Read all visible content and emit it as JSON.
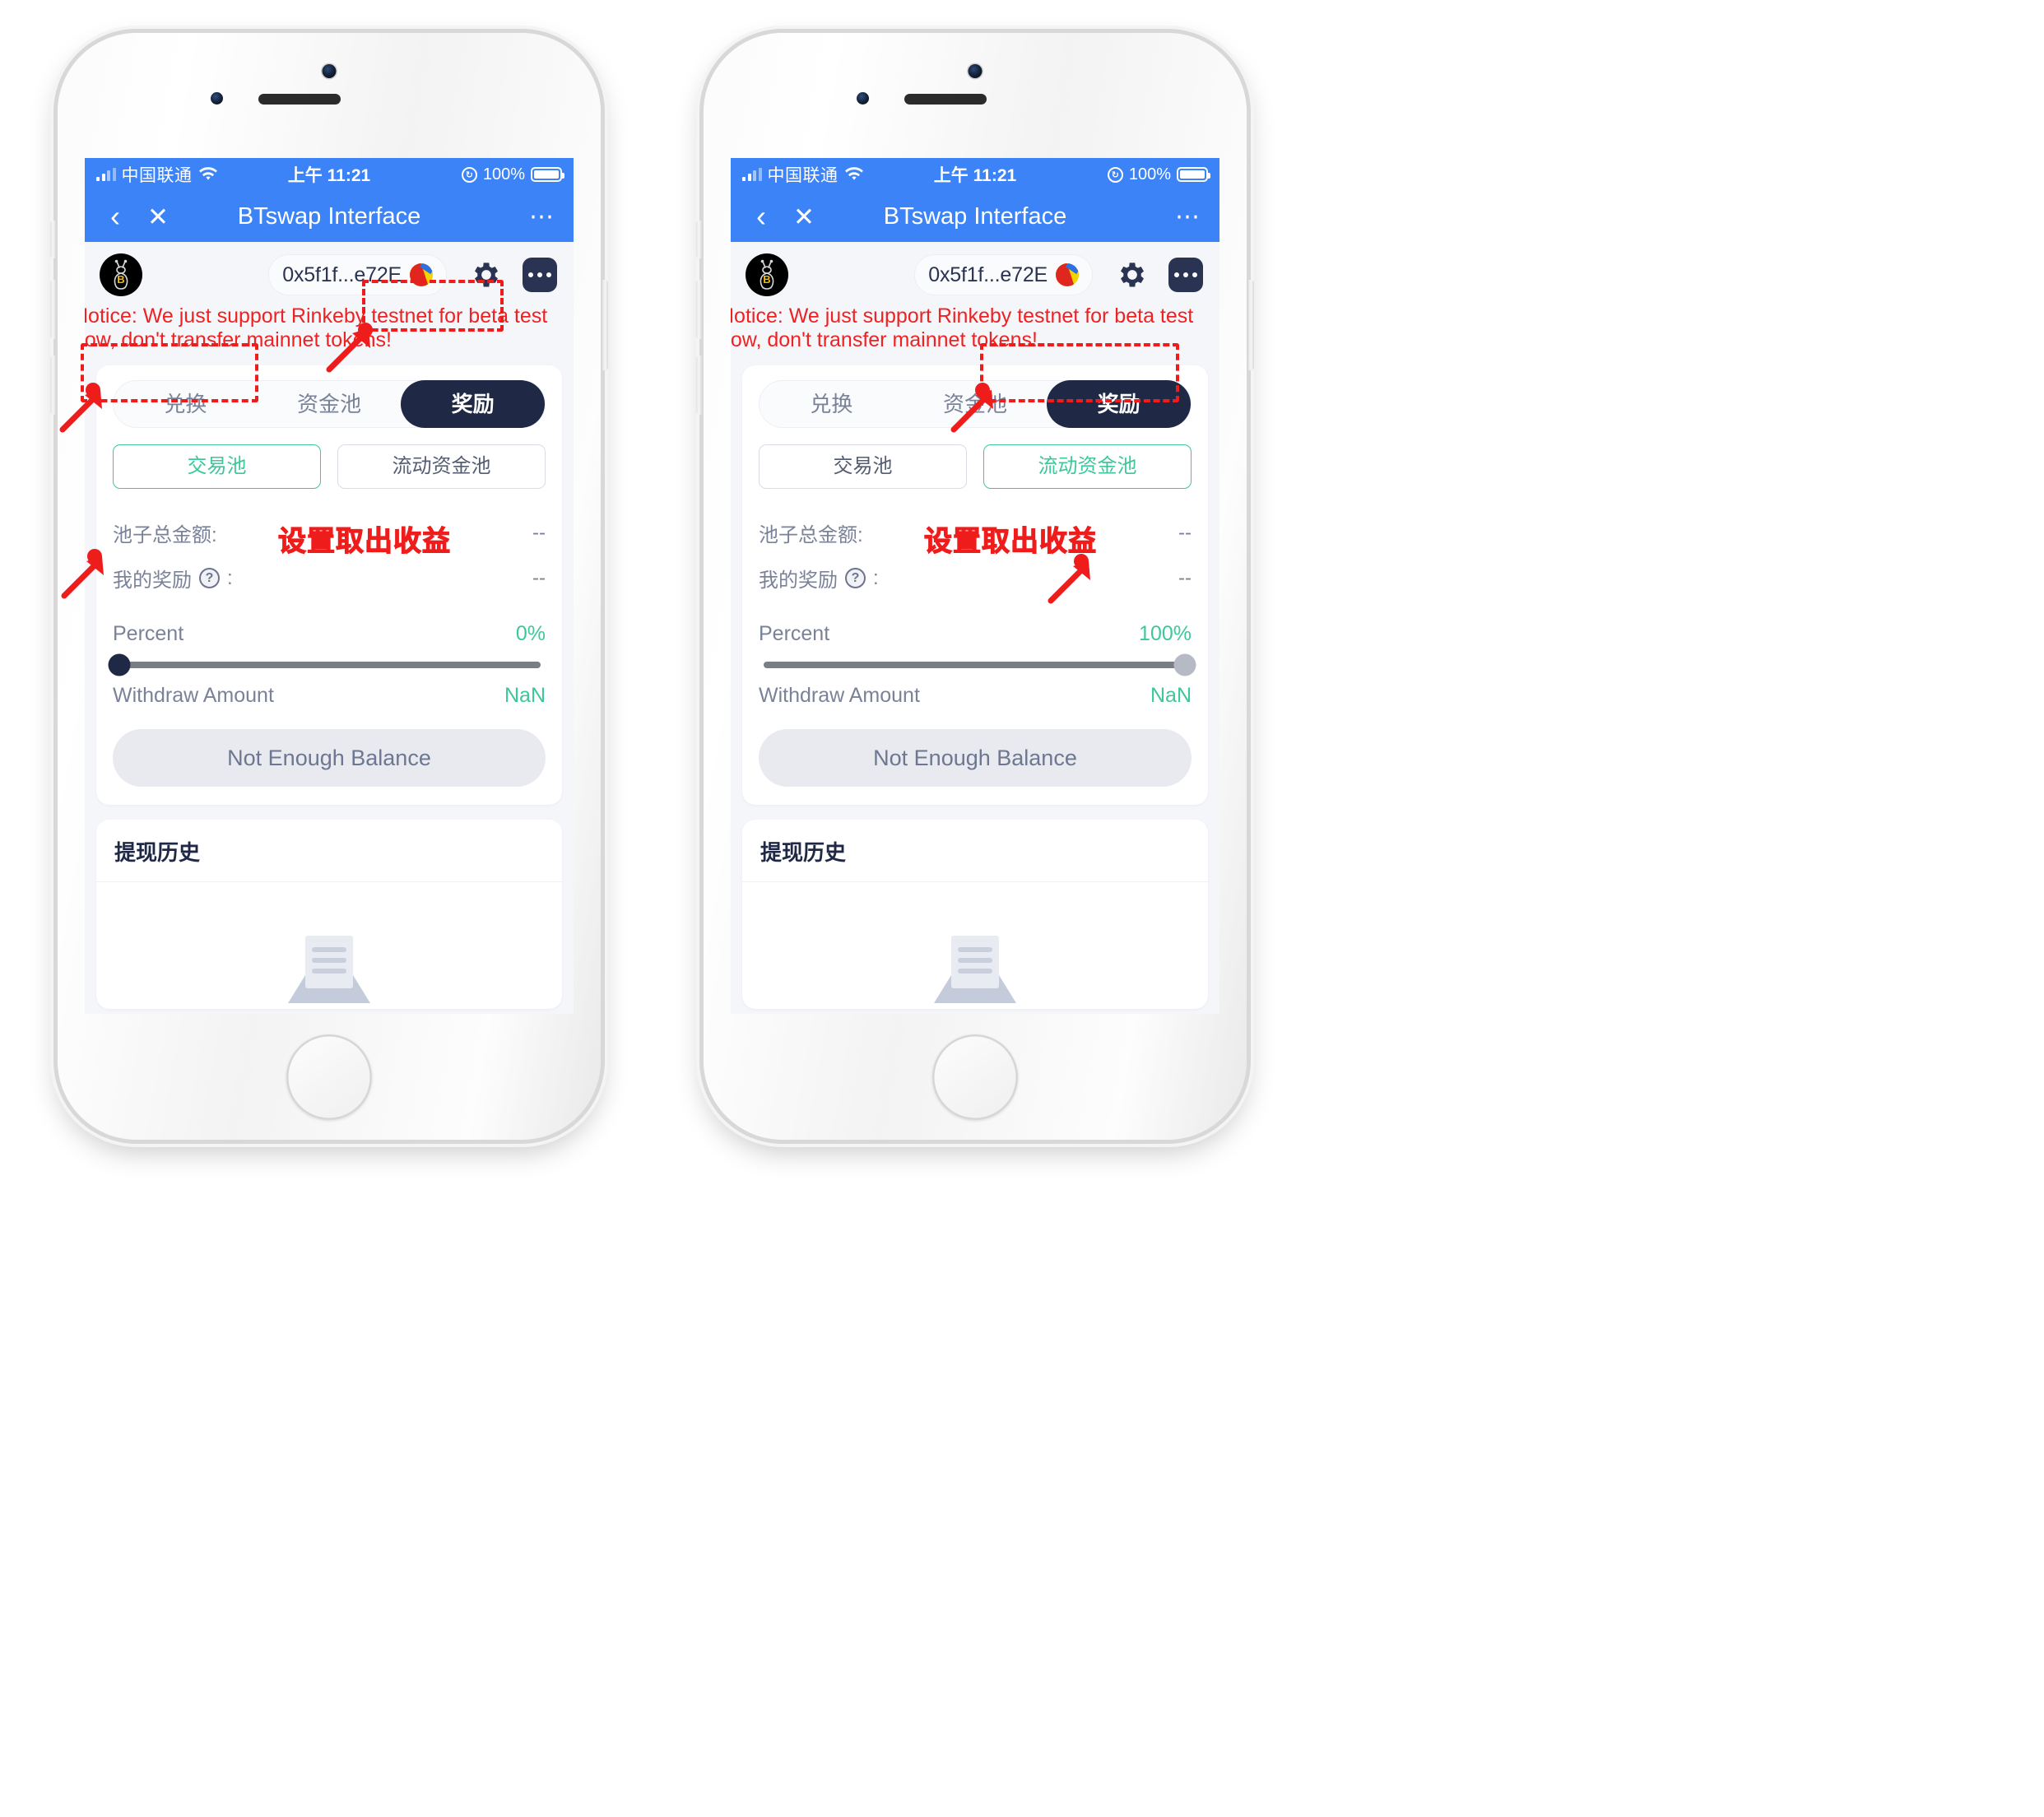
{
  "status_bar": {
    "carrier": "中国联通",
    "time": "上午 11:21",
    "battery_percent": "100%",
    "signal_icon": "signal-bars-icon",
    "wifi_icon": "wifi-icon",
    "rotation_lock_icon": "rotation-lock-icon",
    "battery_icon": "battery-icon"
  },
  "nav_bar": {
    "back_icon": "chevron-left-icon",
    "close_icon": "close-icon",
    "title": "BTswap Interface",
    "more_icon": "ellipsis-icon"
  },
  "app_header": {
    "logo_icon": "btswap-bee-logo-icon",
    "address": "0x5f1f...e72E",
    "avatar_icon": "jazzicon-avatar",
    "settings_icon": "gear-icon",
    "more_icon": "ellipsis-square-icon"
  },
  "notice": {
    "line1": "Notice: We just support Rinkeby testnet for beta test",
    "line2": "now, don't transfer mainnet tokens!",
    "color": "#ee2222"
  },
  "tabs": [
    {
      "label": "兑换",
      "active": false
    },
    {
      "label": "资金池",
      "active": false
    },
    {
      "label": "奖励",
      "active": true
    }
  ],
  "subtabs_left": [
    {
      "label": "交易池",
      "selected": true
    },
    {
      "label": "流动资金池",
      "selected": false
    }
  ],
  "subtabs_right": [
    {
      "label": "交易池",
      "selected": false
    },
    {
      "label": "流动资金池",
      "selected": true
    }
  ],
  "info_rows": [
    {
      "label": "池子总金额:",
      "value": "--",
      "help": false
    },
    {
      "label": "我的奖励",
      "value": "--",
      "help": true,
      "suffix": ":",
      "help_icon": "question-mark-icon"
    }
  ],
  "percent": {
    "label": "Percent",
    "value_left": "0%",
    "value_right": "100%"
  },
  "withdraw": {
    "label": "Withdraw Amount",
    "value": "NaN"
  },
  "cta": {
    "label": "Not Enough Balance"
  },
  "history": {
    "title": "提现历史",
    "empty_icon": "empty-document-icon"
  },
  "annotations": {
    "red_label": "设置取出收益",
    "color": "#ef1c1c"
  },
  "colors": {
    "status_blue": "#3b83f7",
    "accent_navy": "#1f2945",
    "accent_teal": "#3dc79b",
    "annotation_red": "#ef1c1c",
    "muted_text": "#7a8298"
  }
}
